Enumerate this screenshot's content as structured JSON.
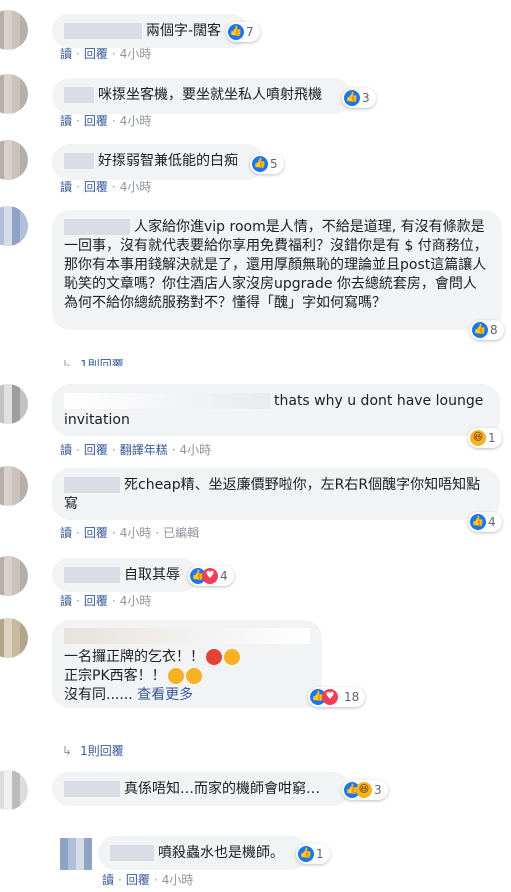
{
  "comments": [
    {
      "text": "兩個字-闊客",
      "reaction_count": "7"
    },
    {
      "text": "咪揼坐客機，要坐就坐私人噴射飛機",
      "reaction_count": "3"
    },
    {
      "text": "好揼弱智兼低能的白痴",
      "reaction_count": "5"
    },
    {
      "text": "人家給你進vip room是人情，不給是道理, 有沒有條款是一回事，沒有就代表要給你享用免費福利？沒錯你是有 $ 付商務位，那你有本事用錢解決就是了，還用厚顏無恥的理論並且post這篇讓人恥笑的文章嗎？你住酒店人家沒房upgrade 你去總統套房，會問人為何不給你總統服務對不？懂得「醜」字如何寫嗎？",
      "reaction_count": "8"
    },
    {
      "text": "thats why u dont have lounge invitation",
      "reaction_count": "1"
    },
    {
      "text": "死cheap精、坐返廉價野啦你，左R右R個醜字你知唔知點寫",
      "reaction_count": "4"
    },
    {
      "text": "自取其辱",
      "reaction_count": "4"
    },
    {
      "line1": "一名攞正牌的乞衣！！",
      "line2": "正宗PK西客！！",
      "line3": "沒有同......",
      "see_more": "查看更多",
      "reaction_count": "18"
    },
    {
      "text": "真係唔知…而家的機師會咁窮…",
      "reaction_count": "3"
    },
    {
      "text": "噴殺蟲水也是機師。",
      "reaction_count": "1"
    }
  ],
  "actions": {
    "read": "讀",
    "reply": "回覆",
    "translate": "翻譯年糕",
    "edited": "已編輯",
    "time": "4小時",
    "dot": "·"
  },
  "replies_label": "1則回覆",
  "replies_label_cut": "1則回覆",
  "icons": {
    "like": "thumbs-up-icon",
    "love": "heart-icon",
    "haha": "laughing-face-icon",
    "reply_arrow": "reply-arrow-icon"
  },
  "colors": {
    "link": "#385898",
    "like": "#1877f2",
    "love": "#f33e58",
    "bubble": "#f2f3f5"
  }
}
